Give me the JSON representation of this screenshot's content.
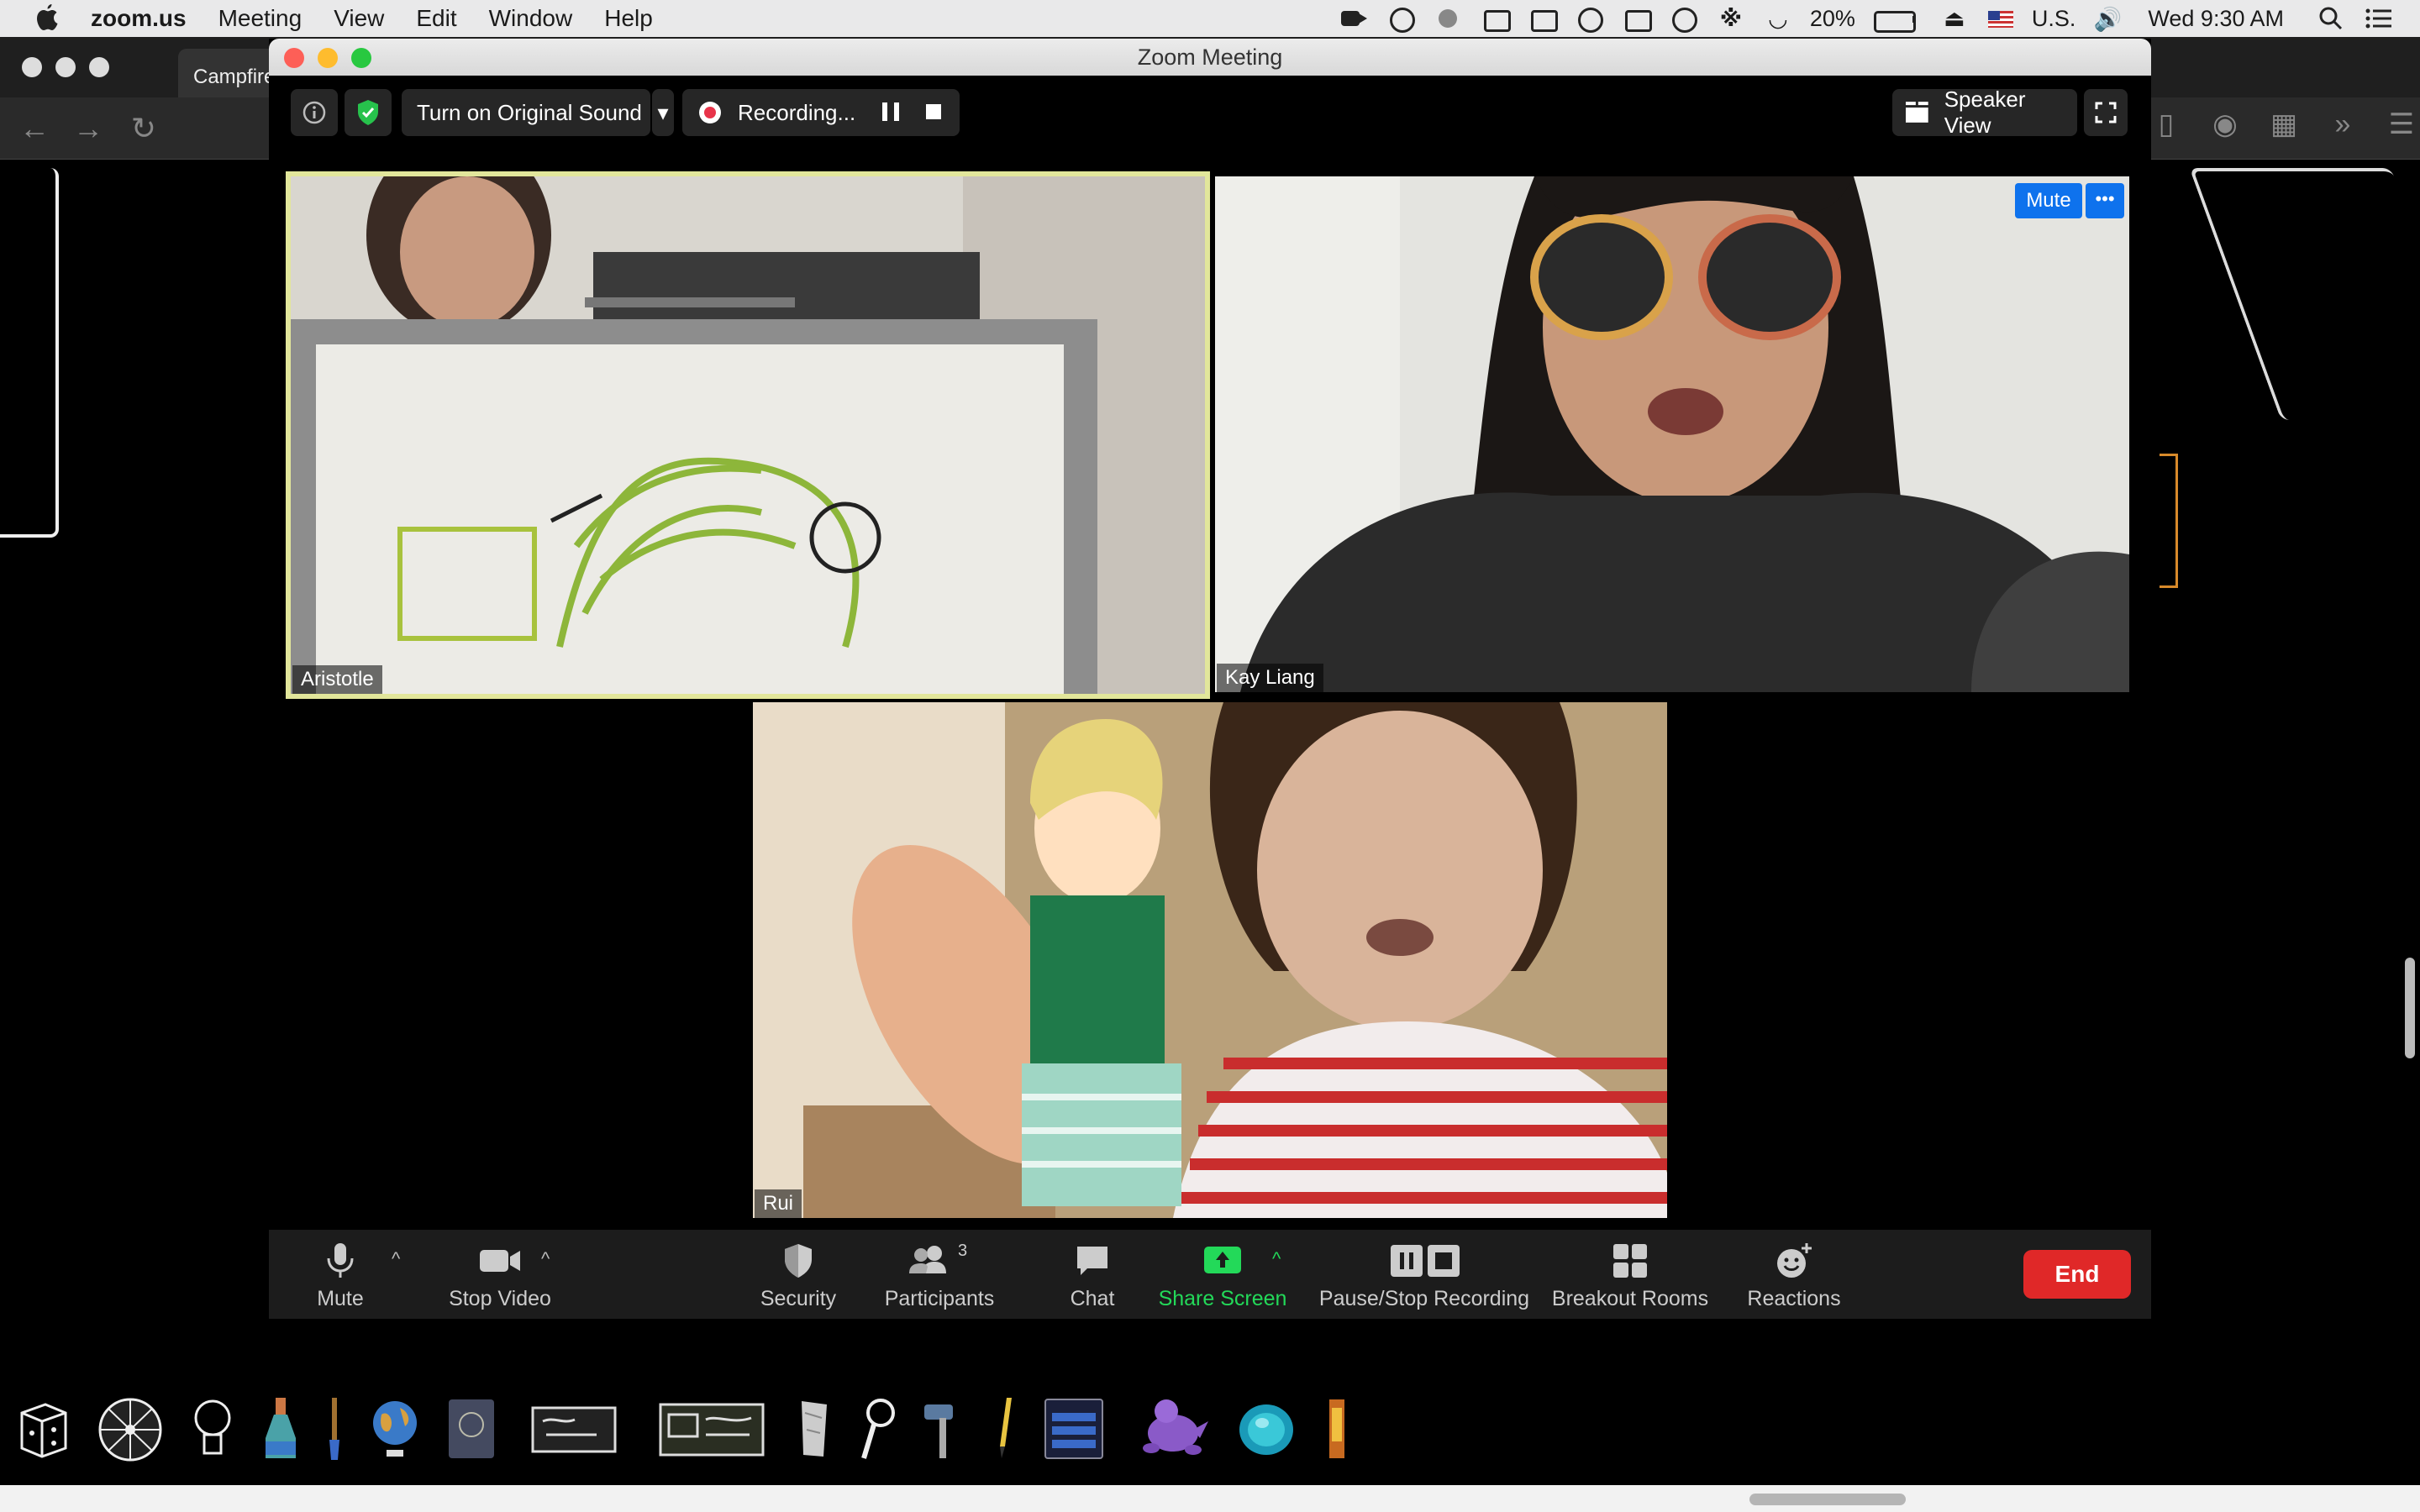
{
  "menubar": {
    "menus": [
      "zoom.us",
      "Meeting",
      "View",
      "Edit",
      "Window",
      "Help"
    ],
    "battery": "20%",
    "input_source": "U.S.",
    "clock": "Wed 9:30 AM"
  },
  "browser": {
    "tab_title": "Campfire"
  },
  "zoom": {
    "window_title": "Zoom Meeting",
    "topbar": {
      "original_sound": "Turn on Original Sound",
      "recording": "Recording...",
      "speaker_view": "Speaker View"
    },
    "participants": [
      {
        "name": "Aristotle"
      },
      {
        "name": "Kay Liang",
        "mute_label": "Mute"
      },
      {
        "name": "Rui"
      }
    ],
    "toolbar": {
      "mute": "Mute",
      "stop_video": "Stop Video",
      "security": "Security",
      "participants": "Participants",
      "participant_count": "3",
      "chat": "Chat",
      "share_screen": "Share Screen",
      "pause_stop_recording": "Pause/Stop Recording",
      "breakout_rooms": "Breakout Rooms",
      "reactions": "Reactions",
      "end": "End"
    }
  },
  "colors": {
    "active_speaker_border": "#e2e69b",
    "share_green": "#23d959",
    "end_red": "#e02828",
    "mute_blue": "#0e72ed",
    "record_red": "#e8344a"
  },
  "icons": {
    "dock": [
      "dice-icon",
      "spinner-wheel-icon",
      "lightbulb-icon",
      "potion-bottle-icon",
      "paintbrush-icon",
      "globe-icon",
      "passport-icon",
      "chalkboard-icon",
      "chalkboard-sign-icon",
      "crumpled-paper-icon",
      "magnifying-glass-icon",
      "hammer-icon",
      "pencil-icon",
      "tablet-screen-icon",
      "dragon-toy-icon",
      "gem-stone-icon",
      "lantern-icon"
    ]
  }
}
